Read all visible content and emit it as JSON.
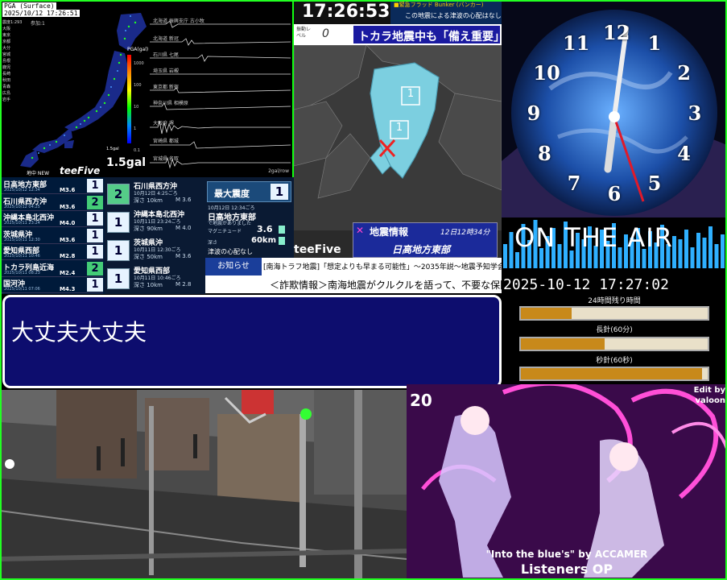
{
  "seismo": {
    "title": "PGA (Surface)",
    "datetime": "2025/10/12 17:26:51",
    "scale_label": "PGA(gal)",
    "scale_values": [
      "1000",
      "100",
      "10",
      "1",
      "0.1"
    ],
    "current_gal_small": "1.5gal",
    "current_gal": "1.5gal",
    "brand": "teeFive",
    "brand_prefix": "地中 NEW",
    "left_list": [
      "震度1:293",
      "大阪",
      "東京",
      "京都",
      "大分",
      "宮城",
      "島根",
      "鹿児",
      "長崎",
      "秋田",
      "青森",
      "広島",
      "岩手"
    ],
    "top_note": "参加:1",
    "stations": [
      "北海道 振興支庁 古小牧",
      "北海道 新冠",
      "石川県 七尾",
      "埼玉県 岩槻",
      "東京都 新宿",
      "神奈川県 相模原",
      "大阪府 堺",
      "宮崎県 都城",
      "宮城県 名取"
    ],
    "unit": "2gal/row"
  },
  "quake_list": [
    {
      "name": "日高地方東部",
      "date": "2025/10/12 12:34",
      "mag": "M3.6",
      "intensity": "1"
    },
    {
      "name": "石川県西方沖",
      "date": "2025/10/12 04:25",
      "mag": "M3.6",
      "intensity": "2"
    },
    {
      "name": "沖縄本島北西沖",
      "date": "2025/10/11 23:24",
      "mag": "M4.0",
      "intensity": "1"
    },
    {
      "name": "茨城県沖",
      "date": "2025/10/11 12:30",
      "mag": "M3.6",
      "intensity": "1"
    },
    {
      "name": "愛知県西部",
      "date": "2025/10/11 10:46",
      "mag": "M2.8",
      "intensity": "1"
    },
    {
      "name": "トカラ列島近海",
      "date": "2025/10/11 08:23",
      "mag": "M2.4",
      "intensity": "2"
    },
    {
      "name": "国河沖",
      "date": "2025/10/11 07:06",
      "mag": "M4.3",
      "intensity": "1"
    }
  ],
  "quake_detail": [
    {
      "badge": "2",
      "name": "石川県西方沖",
      "time": "10月12日 4:25ごろ",
      "depth": "深さ 10km",
      "mag": "M 3.6"
    },
    {
      "badge": "1",
      "name": "沖縄本島北西沖",
      "time": "10月11日 23:24ごろ",
      "depth": "深さ 90km",
      "mag": "M 4.0"
    },
    {
      "badge": "1",
      "name": "茨城県沖",
      "time": "10月11日 12:30ごろ",
      "depth": "深さ 50km",
      "mag": "M 3.6"
    },
    {
      "badge": "1",
      "name": "愛知県西部",
      "time": "10月11日 10:46ごろ",
      "depth": "深さ 10km",
      "mag": "M 2.8"
    }
  ],
  "quake_max": {
    "label": "最大震度",
    "value": "1",
    "time": "10月12日 12:34ごろ",
    "area": "日高地方東部",
    "tsunami": "で地震がありました",
    "mag_label": "マグニチュード",
    "mag_value": "3.6",
    "depth_label": "深さ",
    "depth_value": "60km",
    "note": "津波の心配なし"
  },
  "map": {
    "clock": "17:26:53",
    "banner_top": "■緊急フラッド Bunker (バンカー)",
    "banner_sub": "この地震による津波の心配はなし",
    "level_label": "振動レベル",
    "level_value": "0",
    "headline": "トカラ地震中も「備え重要」",
    "info_title": "地震情報",
    "info_time": "12日12時34分",
    "info_area": "日高地方東部",
    "brand": "teeFive",
    "region_numbers": [
      "1",
      "1"
    ]
  },
  "clock": {
    "numbers": [
      "12",
      "1",
      "2",
      "3",
      "4",
      "5",
      "6",
      "7",
      "8",
      "9",
      "10",
      "11"
    ],
    "on_air": "ON THE AIR",
    "datetime": "2025-10-12 17:27:02",
    "bar1_label": "24時間残り時間",
    "bar1_pct": 0.27,
    "bar2_label": "長針(60分)",
    "bar2_pct": 0.45,
    "bar3_label": "秒針(60秒)",
    "bar3_pct": 0.97
  },
  "notice": {
    "label": "お知らせ",
    "text": "[南海トラフ地震]「想定よりも早まる可能性」〜2035年説〜地震予知学会"
  },
  "ticker": {
    "text": "＜詐欺情報＞南海地震がクルクルを語って、不要な保険"
  },
  "dialog": {
    "text": "大丈夫大丈夫"
  },
  "anime": {
    "number": "20",
    "edit_by_1": "Edit by",
    "edit_by_2": "valoon",
    "song": "\"Into the blue's\" by ACCAMER",
    "listeners": "Listeners OP"
  },
  "colors": {
    "frame_green": "#22ff22",
    "dialog_bg": "#0d0d6e",
    "map_region": "#7ccfe0",
    "bar_fill": "#c8891a"
  }
}
